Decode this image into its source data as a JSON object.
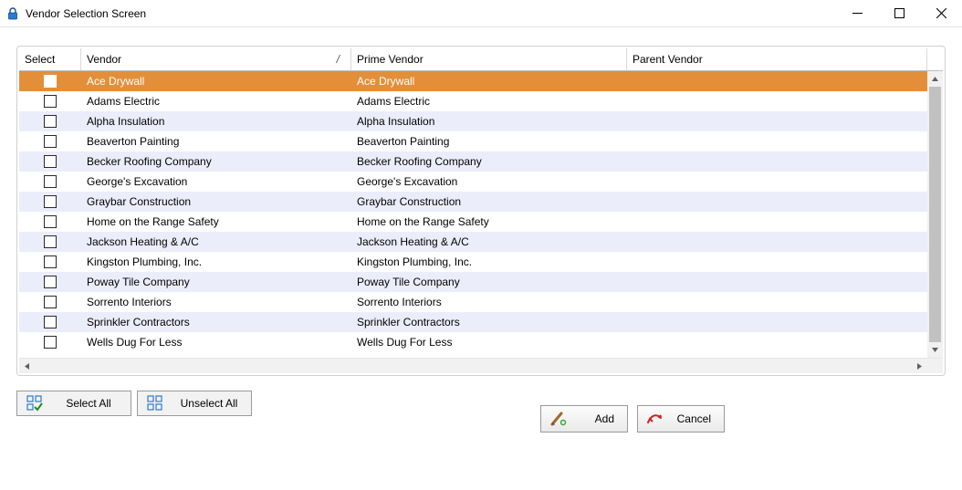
{
  "window": {
    "title": "Vendor Selection Screen"
  },
  "columns": {
    "select": "Select",
    "vendor": "Vendor",
    "prime": "Prime Vendor",
    "parent": "Parent Vendor",
    "sort_indicator": "/"
  },
  "rows": [
    {
      "vendor": "Ace Drywall",
      "prime": "Ace Drywall",
      "parent": "",
      "selected": true
    },
    {
      "vendor": "Adams Electric",
      "prime": "Adams Electric",
      "parent": ""
    },
    {
      "vendor": "Alpha Insulation",
      "prime": "Alpha Insulation",
      "parent": ""
    },
    {
      "vendor": "Beaverton Painting",
      "prime": "Beaverton Painting",
      "parent": ""
    },
    {
      "vendor": "Becker Roofing Company",
      "prime": "Becker Roofing Company",
      "parent": ""
    },
    {
      "vendor": "George's Excavation",
      "prime": "George's Excavation",
      "parent": ""
    },
    {
      "vendor": "Graybar Construction",
      "prime": "Graybar Construction",
      "parent": ""
    },
    {
      "vendor": "Home on the Range Safety",
      "prime": "Home on the Range Safety",
      "parent": ""
    },
    {
      "vendor": "Jackson Heating & A/C",
      "prime": "Jackson Heating & A/C",
      "parent": ""
    },
    {
      "vendor": "Kingston Plumbing, Inc.",
      "prime": "Kingston Plumbing, Inc.",
      "parent": ""
    },
    {
      "vendor": "Poway Tile Company",
      "prime": "Poway Tile Company",
      "parent": ""
    },
    {
      "vendor": "Sorrento Interiors",
      "prime": "Sorrento Interiors",
      "parent": ""
    },
    {
      "vendor": "Sprinkler Contractors",
      "prime": "Sprinkler Contractors",
      "parent": ""
    },
    {
      "vendor": "Wells Dug For Less",
      "prime": "Wells Dug For Less",
      "parent": ""
    }
  ],
  "buttons": {
    "select_all": "Select All",
    "unselect_all": "Unselect All",
    "add": "Add",
    "cancel": "Cancel"
  }
}
